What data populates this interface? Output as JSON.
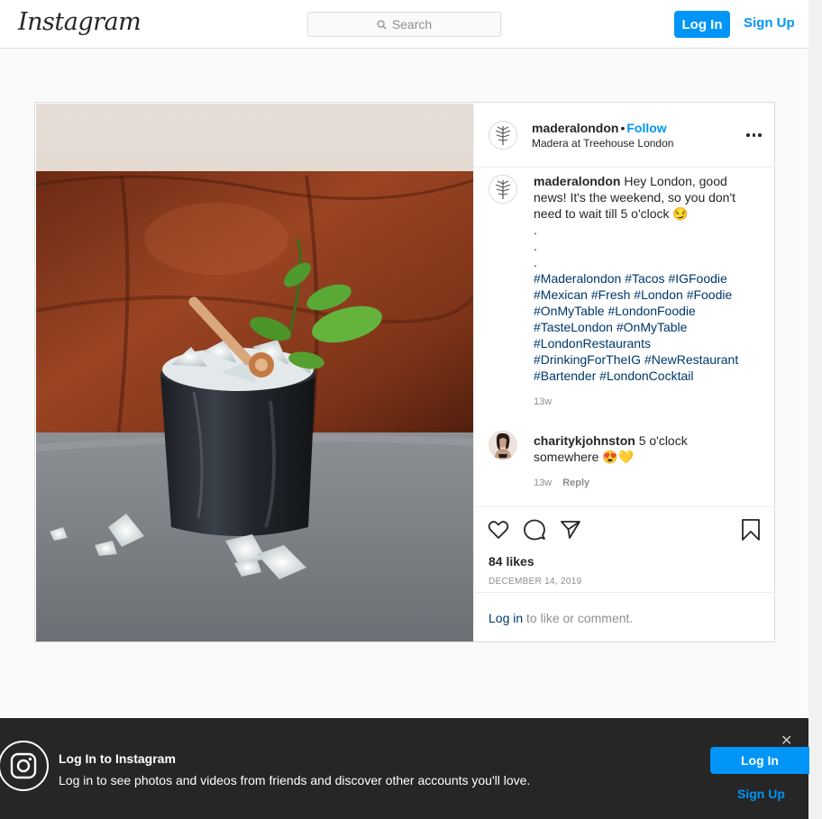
{
  "nav": {
    "logo": "Instagram",
    "search_placeholder": "Search",
    "login_label": "Log In",
    "signup_label": "Sign Up"
  },
  "post": {
    "username": "maderalondon",
    "follow_label": "Follow",
    "separator": "•",
    "location": "Madera at Treehouse London",
    "caption": {
      "username": "maderalondon",
      "text": "Hey London, good news! It's the weekend, so you don't need to wait till 5 o'clock 😏",
      "dots": [
        ".",
        ".",
        "."
      ],
      "hashtags": [
        "#Maderalondon",
        "#Tacos",
        "#IGFoodie",
        "#Mexican",
        "#Fresh",
        "#London",
        "#Foodie",
        "#OnMyTable",
        "#LondonFoodie",
        "#TasteLondon",
        "#OnMyTable",
        "#LondonRestaurants",
        "#DrinkingForTheIG",
        "#NewRestaurant",
        "#Bartender",
        "#LondonCocktail"
      ],
      "time": "13w"
    },
    "comments": [
      {
        "username": "charitykjohnston",
        "text": "5 o'clock somewhere 😍💛",
        "time": "13w",
        "reply_label": "Reply"
      }
    ],
    "likes": "84 likes",
    "date": "DECEMBER 14, 2019",
    "login_link": "Log in",
    "login_suffix": "to like or comment."
  },
  "banner": {
    "title": "Log In to Instagram",
    "subtitle": "Log in to see photos and videos from friends and discover other accounts you'll love.",
    "login_label": "Log In",
    "signup_label": "Sign Up",
    "close_icon": "✕"
  },
  "colors": {
    "accent": "#0095f6",
    "hashtag": "#00376b",
    "banner_bg": "#262626"
  }
}
